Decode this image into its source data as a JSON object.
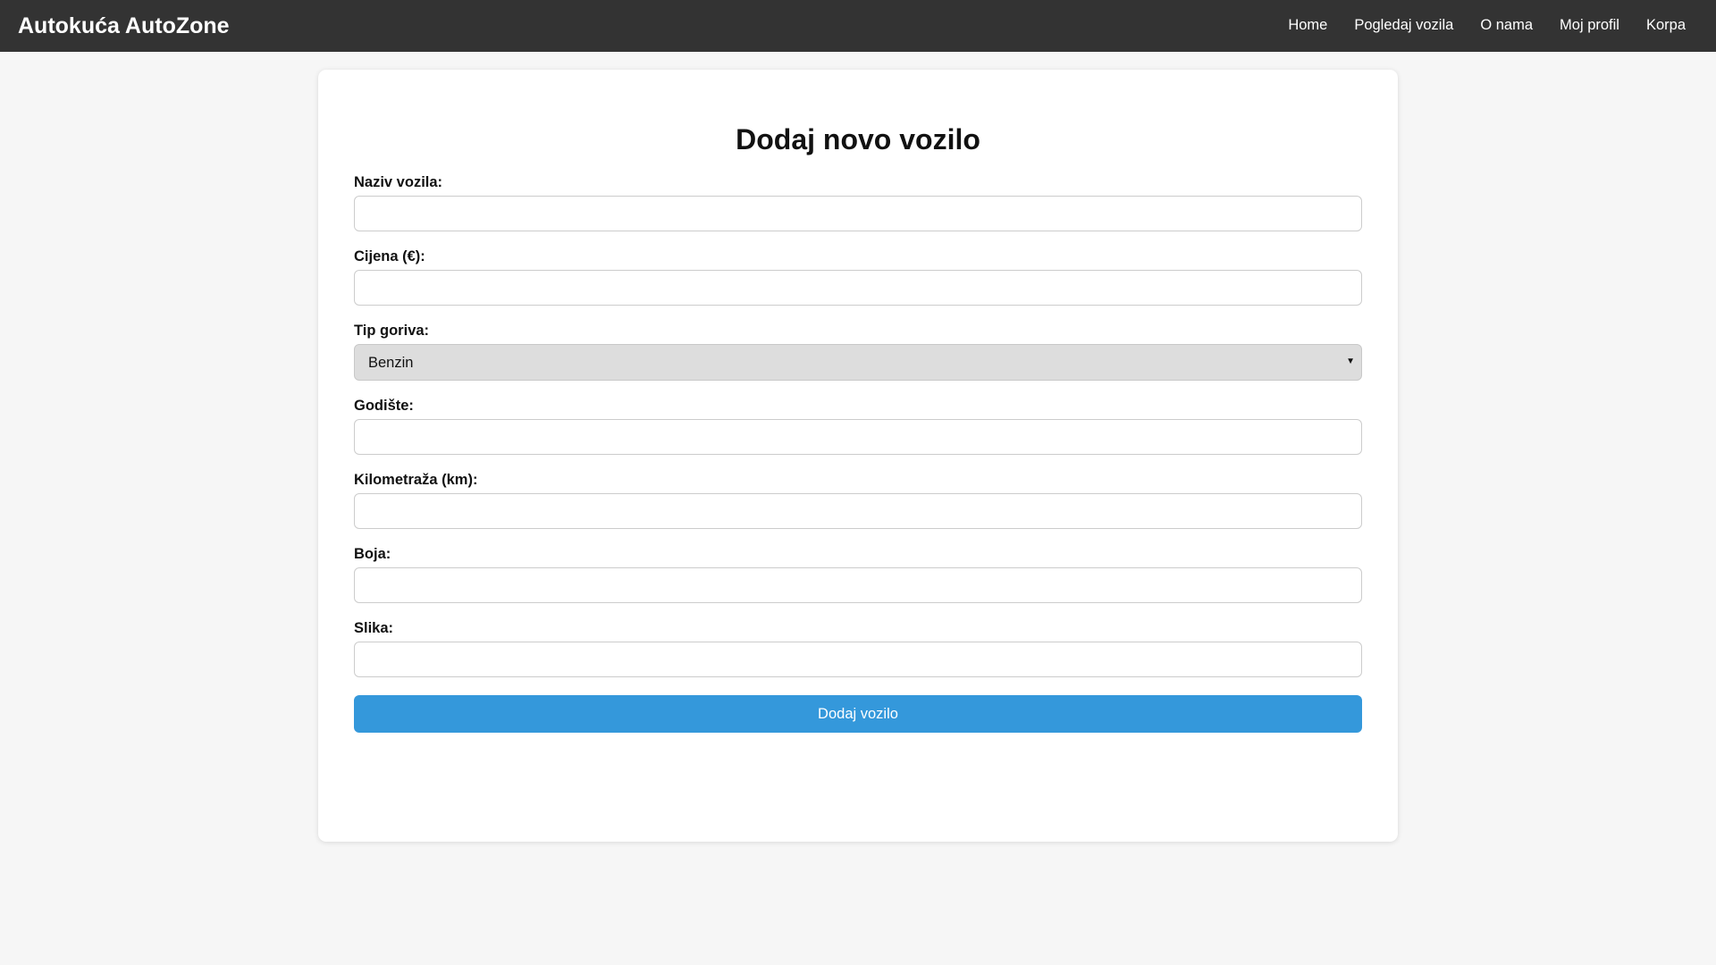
{
  "header": {
    "brand": "Autokuća AutoZone",
    "nav": [
      "Home",
      "Pogledaj vozila",
      "O nama",
      "Moj profil",
      "Korpa"
    ]
  },
  "form": {
    "title": "Dodaj novo vozilo",
    "fields": {
      "name": {
        "label": "Naziv vozila:",
        "value": ""
      },
      "price": {
        "label": "Cijena (€):",
        "value": ""
      },
      "fuel": {
        "label": "Tip goriva:",
        "selected": "Benzin"
      },
      "year": {
        "label": "Godište:",
        "value": ""
      },
      "mileage": {
        "label": "Kilometraža (km):",
        "value": ""
      },
      "color": {
        "label": "Boja:",
        "value": ""
      },
      "image": {
        "label": "Slika:",
        "value": ""
      }
    },
    "submit_label": "Dodaj vozilo"
  },
  "colors": {
    "topbar": "#333333",
    "page_bg": "#f6f6f6",
    "card_bg": "#ffffff",
    "primary_button": "#3498db",
    "select_bg": "#dddddd"
  },
  "icons": {
    "select_arrow": "caret-down-icon"
  }
}
